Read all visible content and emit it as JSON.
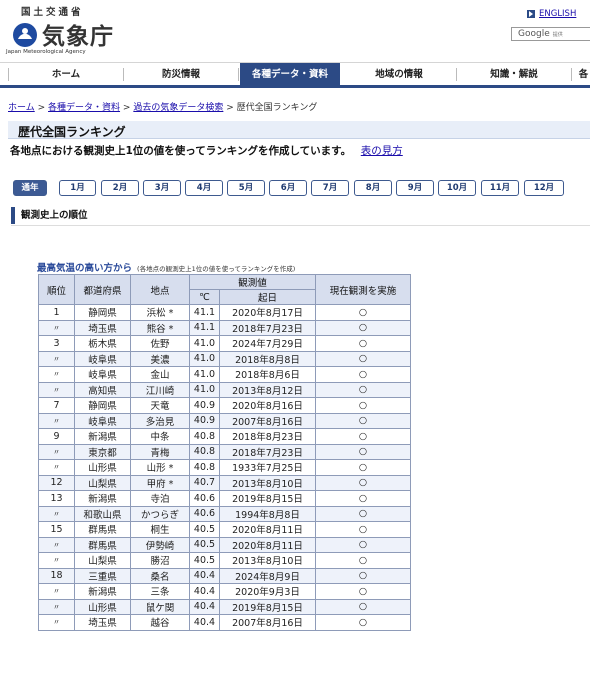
{
  "header": {
    "ministry": "国土交通省",
    "logo_text": "気象庁",
    "logo_sub": "Japan Meteorological Agency",
    "english_link": "ENGLISH",
    "search_brand": "Google",
    "search_sub": "提供"
  },
  "nav": {
    "items": [
      {
        "label": "ホーム"
      },
      {
        "label": "防災情報"
      },
      {
        "label": "各種データ・資料"
      },
      {
        "label": "地域の情報"
      },
      {
        "label": "知識・解説"
      },
      {
        "label": "各"
      }
    ]
  },
  "breadcrumb": {
    "items": [
      "ホーム",
      "各種データ・資料",
      "過去の気象データ検索"
    ],
    "current": "歴代全国ランキング",
    "separator": ">"
  },
  "page": {
    "title": "歴代全国ランキング",
    "description": "各地点における観測史上1位の値を使ってランキングを作成しています。",
    "help_link": "表の見方",
    "section_title": "観測史上の順位"
  },
  "months": [
    "通年",
    "1月",
    "2月",
    "3月",
    "4月",
    "5月",
    "6月",
    "7月",
    "8月",
    "9月",
    "10月",
    "11月",
    "12月"
  ],
  "table": {
    "caption": "最高気温の高い方から",
    "caption_sub": "(各地点の観測史上1位の値を使ってランキングを作成)",
    "headers": {
      "rank": "順位",
      "pref": "都道府県",
      "site": "地点",
      "obs_value": "観測値",
      "unit": "℃",
      "date": "起日",
      "current": "現在観測を実施"
    },
    "rows": [
      {
        "rank": "1",
        "pref": "静岡県",
        "site": "浜松 *",
        "value": "41.1",
        "date": "2020年8月17日",
        "current": "○"
      },
      {
        "rank": "〃",
        "pref": "埼玉県",
        "site": "熊谷 *",
        "value": "41.1",
        "date": "2018年7月23日",
        "current": "○"
      },
      {
        "rank": "3",
        "pref": "栃木県",
        "site": "佐野",
        "value": "41.0",
        "date": "2024年7月29日",
        "current": "○"
      },
      {
        "rank": "〃",
        "pref": "岐阜県",
        "site": "美濃",
        "value": "41.0",
        "date": "2018年8月8日",
        "current": "○"
      },
      {
        "rank": "〃",
        "pref": "岐阜県",
        "site": "金山",
        "value": "41.0",
        "date": "2018年8月6日",
        "current": "○"
      },
      {
        "rank": "〃",
        "pref": "高知県",
        "site": "江川崎",
        "value": "41.0",
        "date": "2013年8月12日",
        "current": "○"
      },
      {
        "rank": "7",
        "pref": "静岡県",
        "site": "天竜",
        "value": "40.9",
        "date": "2020年8月16日",
        "current": "○"
      },
      {
        "rank": "〃",
        "pref": "岐阜県",
        "site": "多治見",
        "value": "40.9",
        "date": "2007年8月16日",
        "current": "○"
      },
      {
        "rank": "9",
        "pref": "新潟県",
        "site": "中条",
        "value": "40.8",
        "date": "2018年8月23日",
        "current": "○"
      },
      {
        "rank": "〃",
        "pref": "東京都",
        "site": "青梅",
        "value": "40.8",
        "date": "2018年7月23日",
        "current": "○"
      },
      {
        "rank": "〃",
        "pref": "山形県",
        "site": "山形 *",
        "value": "40.8",
        "date": "1933年7月25日",
        "current": "○"
      },
      {
        "rank": "12",
        "pref": "山梨県",
        "site": "甲府 *",
        "value": "40.7",
        "date": "2013年8月10日",
        "current": "○"
      },
      {
        "rank": "13",
        "pref": "新潟県",
        "site": "寺泊",
        "value": "40.6",
        "date": "2019年8月15日",
        "current": "○"
      },
      {
        "rank": "〃",
        "pref": "和歌山県",
        "site": "かつらぎ",
        "value": "40.6",
        "date": "1994年8月8日",
        "current": "○"
      },
      {
        "rank": "15",
        "pref": "群馬県",
        "site": "桐生",
        "value": "40.5",
        "date": "2020年8月11日",
        "current": "○"
      },
      {
        "rank": "〃",
        "pref": "群馬県",
        "site": "伊勢崎",
        "value": "40.5",
        "date": "2020年8月11日",
        "current": "○"
      },
      {
        "rank": "〃",
        "pref": "山梨県",
        "site": "勝沼",
        "value": "40.5",
        "date": "2013年8月10日",
        "current": "○"
      },
      {
        "rank": "18",
        "pref": "三重県",
        "site": "桑名",
        "value": "40.4",
        "date": "2024年8月9日",
        "current": "○"
      },
      {
        "rank": "〃",
        "pref": "新潟県",
        "site": "三条",
        "value": "40.4",
        "date": "2020年9月3日",
        "current": "○"
      },
      {
        "rank": "〃",
        "pref": "山形県",
        "site": "鼠ケ関",
        "value": "40.4",
        "date": "2019年8月15日",
        "current": "○"
      },
      {
        "rank": "〃",
        "pref": "埼玉県",
        "site": "越谷",
        "value": "40.4",
        "date": "2007年8月16日",
        "current": "○"
      }
    ]
  }
}
